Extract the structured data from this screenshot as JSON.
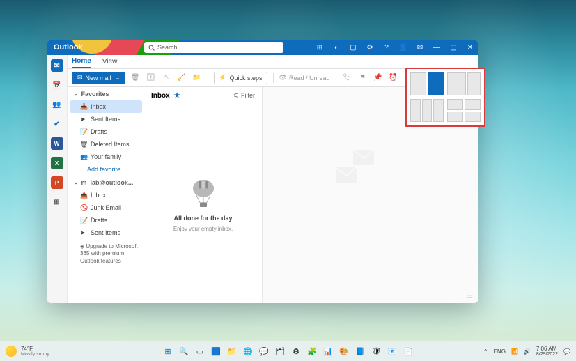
{
  "app": {
    "name": "Outlook"
  },
  "search": {
    "placeholder": "Search"
  },
  "tabs": {
    "home": "Home",
    "view": "View"
  },
  "ribbon": {
    "newmail": "New mail",
    "quicksteps": "Quick steps",
    "readunread": "Read / Unread"
  },
  "sidebar": {
    "favorites": "Favorites",
    "inbox": "Inbox",
    "sentitems": "Sent Items",
    "drafts": "Drafts",
    "deleted": "Deleted Items",
    "yourfamily": "Your family",
    "addfav": "Add favorite",
    "account": "m_lab@outlook...",
    "acc_inbox": "Inbox",
    "acc_junk": "Junk Email",
    "acc_drafts": "Drafts",
    "acc_sent": "Sent Items",
    "upgrade": "Upgrade to Microsoft 365 with premium Outlook features"
  },
  "msglist": {
    "title": "Inbox",
    "filter": "Filter",
    "empty_title": "All done for the day",
    "empty_sub": "Enjoy your empty inbox."
  },
  "weather": {
    "temp": "74°F",
    "cond": "Mostly sunny"
  },
  "tray": {
    "lang": "ENG",
    "time": "7:06 AM",
    "date": "8/29/2022"
  }
}
